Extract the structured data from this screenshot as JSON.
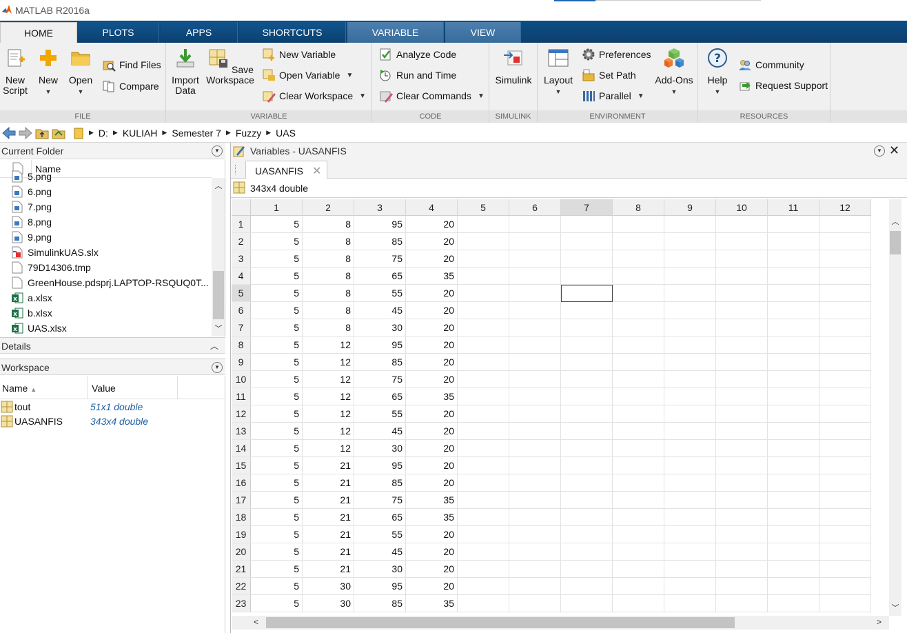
{
  "app": {
    "title": "MATLAB R2016a"
  },
  "tabs": [
    "HOME",
    "PLOTS",
    "APPS",
    "SHORTCUTS",
    "VARIABLE",
    "VIEW"
  ],
  "ribbon": {
    "file": {
      "label": "FILE",
      "new_script": [
        "New",
        "Script"
      ],
      "new": "New",
      "open": "Open",
      "find_files": "Find Files",
      "compare": "Compare"
    },
    "variable": {
      "label": "VARIABLE",
      "import": [
        "Import",
        "Data"
      ],
      "save": [
        "Save",
        "Workspace"
      ],
      "new_variable": "New Variable",
      "open_variable": "Open Variable",
      "clear_workspace": "Clear Workspace"
    },
    "code": {
      "label": "CODE",
      "analyze": "Analyze Code",
      "run_time": "Run and Time",
      "clear_commands": "Clear Commands"
    },
    "simulink": {
      "label": "SIMULINK",
      "btn": "Simulink"
    },
    "environment": {
      "label": "ENVIRONMENT",
      "layout": "Layout",
      "preferences": "Preferences",
      "set_path": "Set Path",
      "parallel": "Parallel",
      "addons": "Add-Ons"
    },
    "resources": {
      "label": "RESOURCES",
      "help": "Help",
      "community": "Community",
      "request_support": "Request Support"
    }
  },
  "path": [
    "D:",
    "KULIAH",
    "Semester 7",
    "Fuzzy",
    "UAS"
  ],
  "current_folder": {
    "title": "Current Folder",
    "col_name": "Name",
    "files": [
      {
        "name": "5.png",
        "type": "png"
      },
      {
        "name": "6.png",
        "type": "png"
      },
      {
        "name": "7.png",
        "type": "png"
      },
      {
        "name": "8.png",
        "type": "png"
      },
      {
        "name": "9.png",
        "type": "png"
      },
      {
        "name": "SimulinkUAS.slx",
        "type": "slx"
      },
      {
        "name": "79D14306.tmp",
        "type": "file"
      },
      {
        "name": "GreenHouse.pdsprj.LAPTOP-RSQUQ0T...",
        "type": "file"
      },
      {
        "name": "a.xlsx",
        "type": "xlsx"
      },
      {
        "name": "b.xlsx",
        "type": "xlsx"
      },
      {
        "name": "UAS.xlsx",
        "type": "xlsx"
      }
    ]
  },
  "details": {
    "title": "Details"
  },
  "workspace": {
    "title": "Workspace",
    "col_name": "Name",
    "col_value": "Value",
    "vars": [
      {
        "name": "tout",
        "value": "51x1 double"
      },
      {
        "name": "UASANFIS",
        "value": "343x4 double"
      }
    ]
  },
  "variables_editor": {
    "title": "Variables - UASANFIS",
    "tab": "UASANFIS",
    "info": "343x4 double",
    "columns": [
      "1",
      "2",
      "3",
      "4",
      "5",
      "6",
      "7",
      "8",
      "9",
      "10",
      "11",
      "12"
    ],
    "rows": [
      [
        5,
        8,
        95,
        20
      ],
      [
        5,
        8,
        85,
        20
      ],
      [
        5,
        8,
        75,
        20
      ],
      [
        5,
        8,
        65,
        35
      ],
      [
        5,
        8,
        55,
        20
      ],
      [
        5,
        8,
        45,
        20
      ],
      [
        5,
        8,
        30,
        20
      ],
      [
        5,
        12,
        95,
        20
      ],
      [
        5,
        12,
        85,
        20
      ],
      [
        5,
        12,
        75,
        20
      ],
      [
        5,
        12,
        65,
        35
      ],
      [
        5,
        12,
        55,
        20
      ],
      [
        5,
        12,
        45,
        20
      ],
      [
        5,
        12,
        30,
        20
      ],
      [
        5,
        21,
        95,
        20
      ],
      [
        5,
        21,
        85,
        20
      ],
      [
        5,
        21,
        75,
        35
      ],
      [
        5,
        21,
        65,
        35
      ],
      [
        5,
        21,
        55,
        20
      ],
      [
        5,
        21,
        45,
        20
      ],
      [
        5,
        21,
        30,
        20
      ],
      [
        5,
        30,
        95,
        20
      ],
      [
        5,
        30,
        85,
        35
      ]
    ],
    "selected_row": 5,
    "selected_col": 7
  },
  "colors": {
    "ribbon_tab_bg": "#0b4a80",
    "ribbon_bg": "#f0f0f0",
    "value_blue": "#1f5fa0"
  }
}
